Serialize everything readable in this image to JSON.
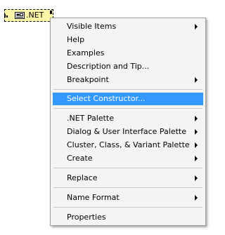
{
  "node": {
    "label": ".NET",
    "icon": "dotnet-constructor-icon",
    "bg_color": "#fff7a8"
  },
  "menu": {
    "highlight_color": "#3399ff",
    "items": [
      {
        "label": "Visible Items",
        "submenu": true
      },
      {
        "label": "Help",
        "submenu": false
      },
      {
        "label": "Examples",
        "submenu": false
      },
      {
        "label": "Description and Tip...",
        "submenu": false
      },
      {
        "label": "Breakpoint",
        "submenu": true
      },
      {
        "label": "Select Constructor...",
        "submenu": false,
        "highlighted": true
      },
      {
        "label": ".NET Palette",
        "submenu": true
      },
      {
        "label": "Dialog & User Interface Palette",
        "submenu": true
      },
      {
        "label": "Cluster, Class, & Variant Palette",
        "submenu": true
      },
      {
        "label": "Create",
        "submenu": true
      },
      {
        "label": "Replace",
        "submenu": true
      },
      {
        "label": "Name Format",
        "submenu": true
      },
      {
        "label": "Properties",
        "submenu": false
      }
    ]
  }
}
